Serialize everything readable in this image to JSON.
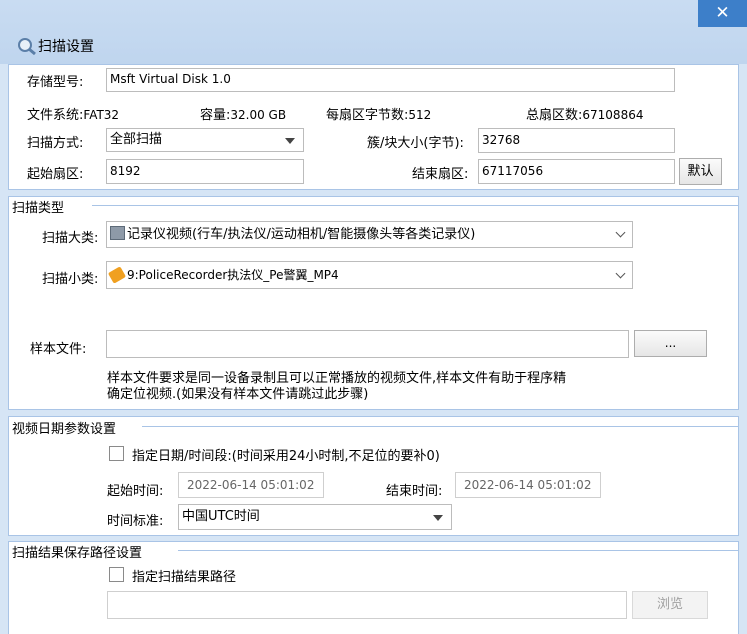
{
  "window": {
    "title": "扫描设置",
    "close_glyph": "✕"
  },
  "disk": {
    "model_label": "存储型号:",
    "model_value": "Msft   Virtual Disk   1.0",
    "fs_label": "文件系统:",
    "fs_value": "FAT32",
    "capacity_label": "容量:",
    "capacity_value": "32.00 GB",
    "bps_label": "每扇区字节数:",
    "bps_value": "512",
    "total_label": "总扇区数:",
    "total_value": "67108864",
    "scan_mode_label": "扫描方式:",
    "scan_mode_value": "全部扫描",
    "cluster_label": "簇/块大小(字节):",
    "cluster_value": "32768",
    "start_label": "起始扇区:",
    "start_value": "8192",
    "end_label": "结束扇区:",
    "end_value": "67117056",
    "default_button": "默认"
  },
  "scan_type": {
    "group_title": "扫描类型",
    "major_label": "扫描大类:",
    "major_value": "记录仪视频(行车/执法仪/运动相机/智能摄像头等各类记录仪)",
    "minor_label": "扫描小类:",
    "minor_value": "9:PoliceRecorder执法仪_Pe警翼_MP4",
    "sample_label": "样本文件:",
    "sample_value": "",
    "browse_button": "...",
    "hint_line1": "样本文件要求是同一设备录制且可以正常播放的视频文件,样本文件有助于程序精",
    "hint_line2": "确定位视频.(如果没有样本文件请跳过此步骤)"
  },
  "video_date": {
    "group_title": "视频日期参数设置",
    "checkbox_label": "指定日期/时间段:(时间采用24小时制,不足位的要补0)",
    "start_label": "起始时间:",
    "start_value": "2022-06-14 05:01:02",
    "end_label": "结束时间:",
    "end_value": "2022-06-14 05:01:02",
    "tz_label": "时间标准:",
    "tz_value": "中国UTC时间"
  },
  "result_path": {
    "group_title": "扫描结果保存路径设置",
    "checkbox_label": "指定扫描结果路径",
    "path_value": "",
    "browse_button": "浏览"
  },
  "colors": {
    "accent": "#3d7fc9",
    "frame": "#d6e5f5",
    "border": "#a9c4e6"
  }
}
